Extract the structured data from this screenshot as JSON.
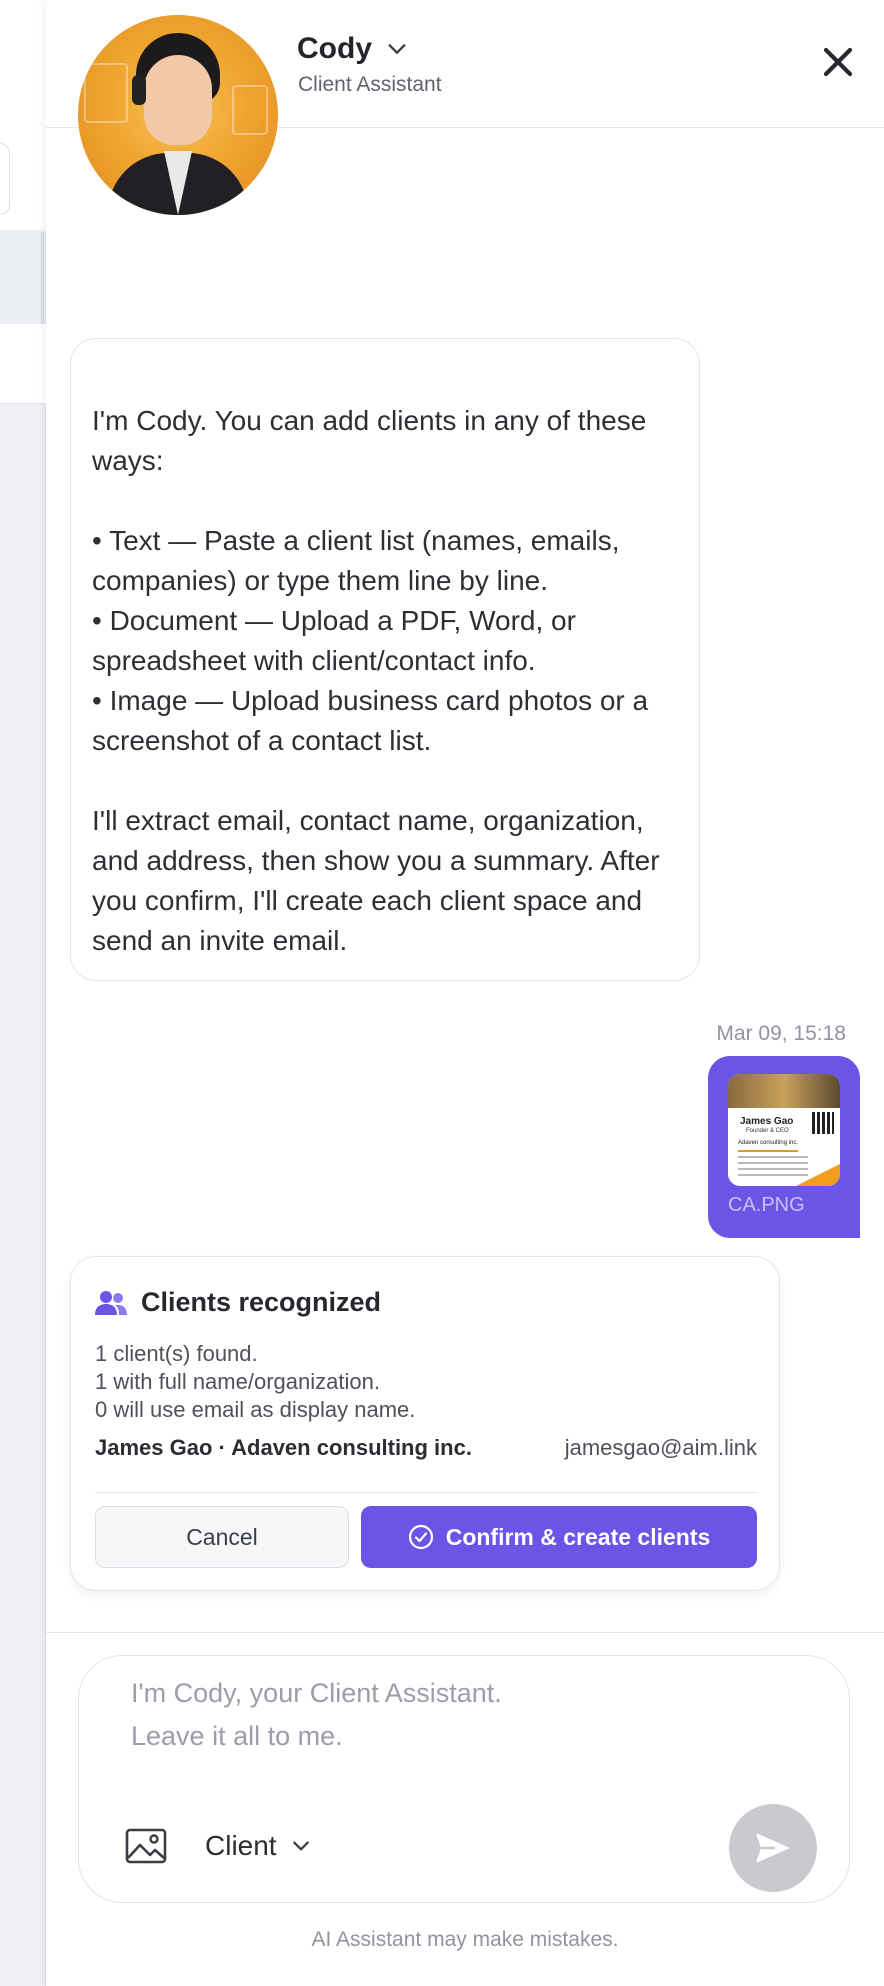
{
  "header": {
    "name": "Cody",
    "role": "Client Assistant"
  },
  "messages": {
    "assistant_intro": "I'm Cody. You can add clients in any of these ways:\n\n• Text — Paste a client list (names, emails, companies) or type them line by line.\n• Document — Upload a PDF, Word, or spreadsheet with client/contact info.\n• Image — Upload business card photos or a screenshot of a contact list.\n\nI'll extract email, contact name, organization, and address, then show you a summary. After you confirm, I'll create each client space and send an invite email.",
    "timestamp": "Mar 09, 15:18",
    "user_attachment": {
      "file_name": "CA.PNG",
      "card_name": "James Gao",
      "card_title": "Founder & CEO",
      "card_company": "Adaven consulting inc."
    }
  },
  "recognized_card": {
    "title": "Clients recognized",
    "lines": [
      "1 client(s) found.",
      "1 with full name/organization.",
      "0 will use email as display name."
    ],
    "client_name": "James Gao · Adaven consulting inc.",
    "client_email": "jamesgao@aim.link",
    "cancel_label": "Cancel",
    "confirm_label": "Confirm & create clients"
  },
  "composer": {
    "placeholder": "I'm Cody, your Client Assistant.\nLeave it all to me.",
    "mode_label": "Client"
  },
  "disclaimer": "AI Assistant may make mistakes.",
  "colors": {
    "accent": "#6b55e6",
    "send_disabled": "#c8cacf"
  }
}
